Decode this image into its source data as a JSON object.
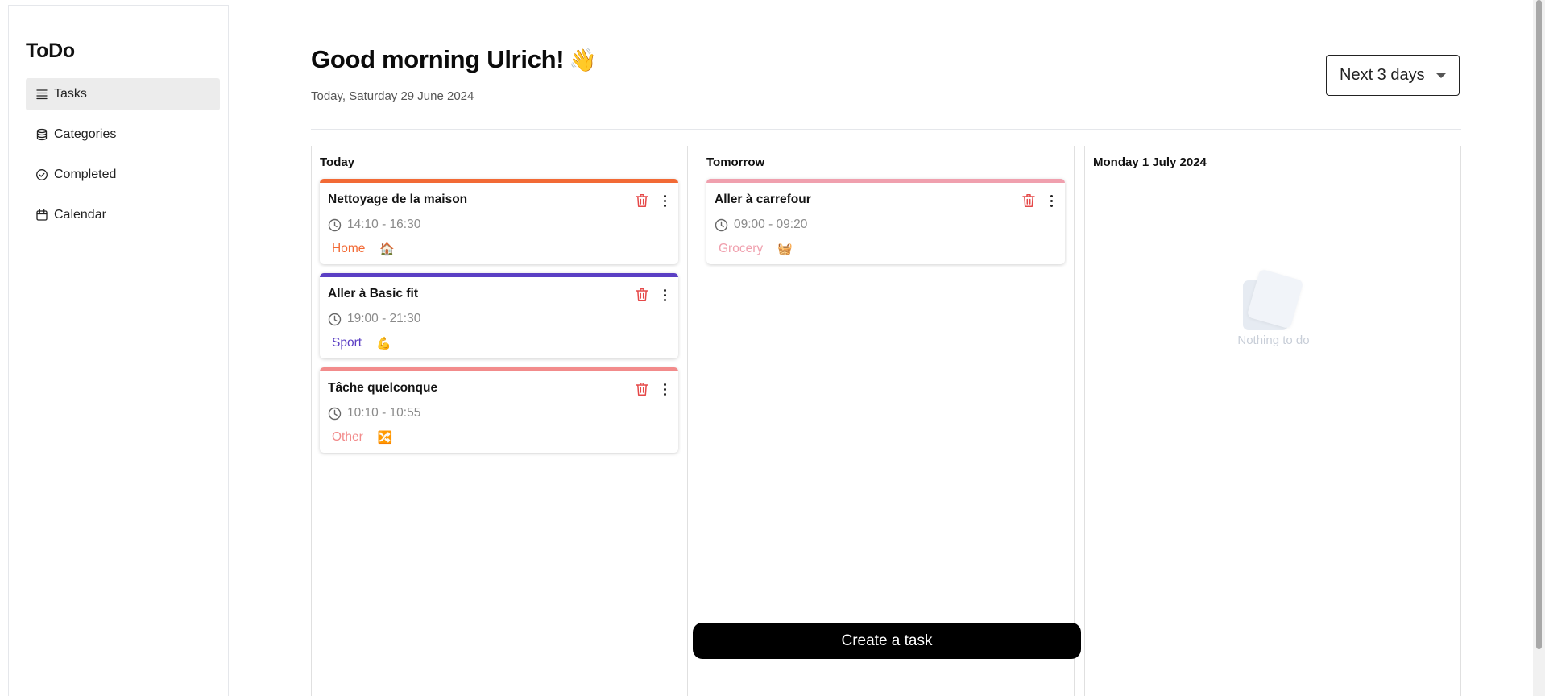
{
  "sidebar": {
    "logo": "ToDo",
    "items": [
      {
        "label": "Tasks",
        "icon": "list-icon",
        "active": true
      },
      {
        "label": "Categories",
        "icon": "database-icon",
        "active": false
      },
      {
        "label": "Completed",
        "icon": "check-circle-icon",
        "active": false
      },
      {
        "label": "Calendar",
        "icon": "calendar-icon",
        "active": false
      }
    ]
  },
  "header": {
    "greeting": "Good morning Ulrich!",
    "wave_emoji": "👋",
    "date": "Today, Saturday 29 June 2024",
    "range_select": "Next 3 days"
  },
  "columns": [
    {
      "heading": "Today",
      "tasks": [
        {
          "title": "Nettoyage de la maison",
          "time": "14:10 - 16:30",
          "category": "Home",
          "emoji": "🏠",
          "color": "#f26a35"
        },
        {
          "title": "Aller à Basic fit",
          "time": "19:00 - 21:30",
          "category": "Sport",
          "emoji": "💪",
          "color": "#5b3fc4"
        },
        {
          "title": "Tâche quelconque",
          "time": "10:10 - 10:55",
          "category": "Other",
          "emoji": "🔀",
          "color": "#f28b8b"
        }
      ]
    },
    {
      "heading": "Tomorrow",
      "tasks": [
        {
          "title": "Aller à carrefour",
          "time": "09:00 - 09:20",
          "category": "Grocery",
          "emoji": "🧺",
          "color": "#f0a0ae"
        }
      ]
    },
    {
      "heading": "Monday 1 July 2024",
      "tasks": [],
      "empty_text": "Nothing to do"
    }
  ],
  "create_button": "Create a task",
  "colors": {
    "accent_black": "#000000",
    "trash_red": "#e54848",
    "category_home": "#f26a35",
    "category_sport": "#5b3fc4",
    "category_other": "#f28b8b",
    "category_grocery": "#f0a0ae"
  }
}
